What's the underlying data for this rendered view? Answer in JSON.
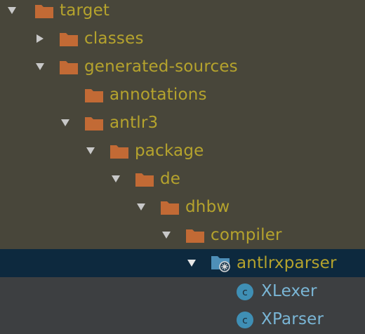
{
  "tree": {
    "items": [
      {
        "label": "target",
        "kind": "folder",
        "expanded": true
      },
      {
        "label": "classes",
        "kind": "folder",
        "expanded": false
      },
      {
        "label": "generated-sources",
        "kind": "folder",
        "expanded": true
      },
      {
        "label": "annotations",
        "kind": "folder",
        "expanded": null
      },
      {
        "label": "antlr3",
        "kind": "folder",
        "expanded": true
      },
      {
        "label": "package",
        "kind": "folder",
        "expanded": true
      },
      {
        "label": "de",
        "kind": "folder",
        "expanded": true
      },
      {
        "label": "dhbw",
        "kind": "folder",
        "expanded": true
      },
      {
        "label": "compiler",
        "kind": "folder",
        "expanded": true
      },
      {
        "label": "antlrxparser",
        "kind": "package-folder",
        "expanded": true,
        "selected": true
      },
      {
        "label": "XLexer",
        "kind": "java-class",
        "expanded": null
      },
      {
        "label": "XParser",
        "kind": "java-class",
        "expanded": null
      }
    ],
    "icons": {
      "folder": "folder-icon",
      "package_folder": "source-package-icon",
      "java_class": "java-class-icon",
      "expanded": "expanded-arrow-icon",
      "collapsed": "collapsed-arrow-icon"
    },
    "colors": {
      "folder_orange": "#c26a35",
      "package_blue": "#4e8fb8",
      "excluded_label": "#b5a32d",
      "class_label": "#7ab6d6",
      "selection": "#0d293e",
      "class_icon_bg": "#3f8fb5"
    }
  }
}
